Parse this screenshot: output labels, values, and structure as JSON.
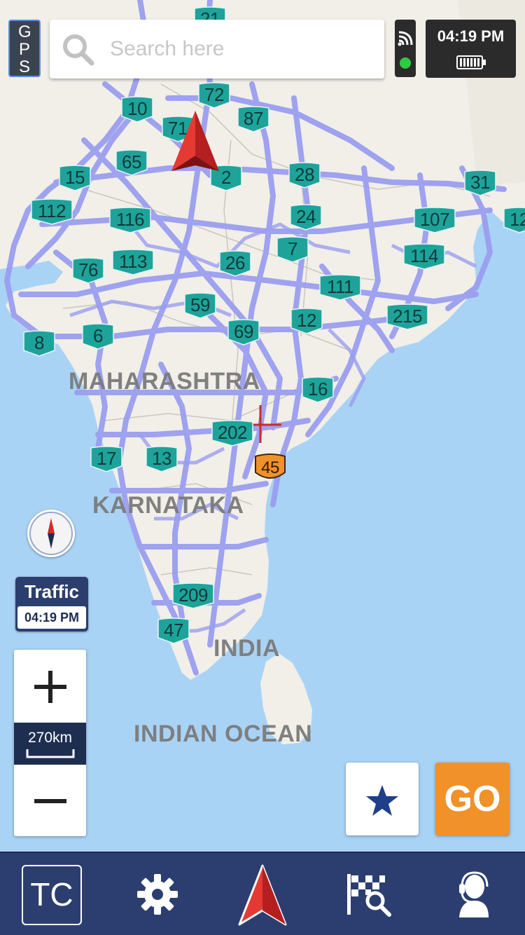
{
  "gps": {
    "label": "GPS"
  },
  "search": {
    "placeholder": "Search here"
  },
  "status": {
    "time": "04:19 PM",
    "gps_fix_color": "#2ecc40"
  },
  "map": {
    "regions": [
      {
        "id": "maharashtra",
        "label": "MAHARASHTRA"
      },
      {
        "id": "karnataka",
        "label": "KARNATAKA"
      },
      {
        "id": "india",
        "label": "INDIA"
      },
      {
        "id": "indian-ocean",
        "label": "INDIAN OCEAN"
      }
    ],
    "highways": [
      "21",
      "72",
      "10",
      "71",
      "87",
      "65",
      "2",
      "28",
      "31",
      "15",
      "112",
      "116",
      "24",
      "107",
      "12",
      "113",
      "7",
      "114",
      "76",
      "26",
      "111",
      "59",
      "215",
      "8",
      "6",
      "69",
      "12",
      "16",
      "202",
      "17",
      "13",
      "209",
      "47"
    ],
    "state_highway": "45"
  },
  "controls": {
    "traffic_label": "Traffic",
    "traffic_time": "04:19 PM",
    "zoom_scale": "270km",
    "go_label": "GO"
  },
  "bottom_nav": {
    "tc_label": "TC"
  },
  "colors": {
    "accent_orange": "#f0912a",
    "nav_blue": "#2c3e70",
    "shield_green": "#1ea39a",
    "road_lavender": "#9b9ef0"
  }
}
